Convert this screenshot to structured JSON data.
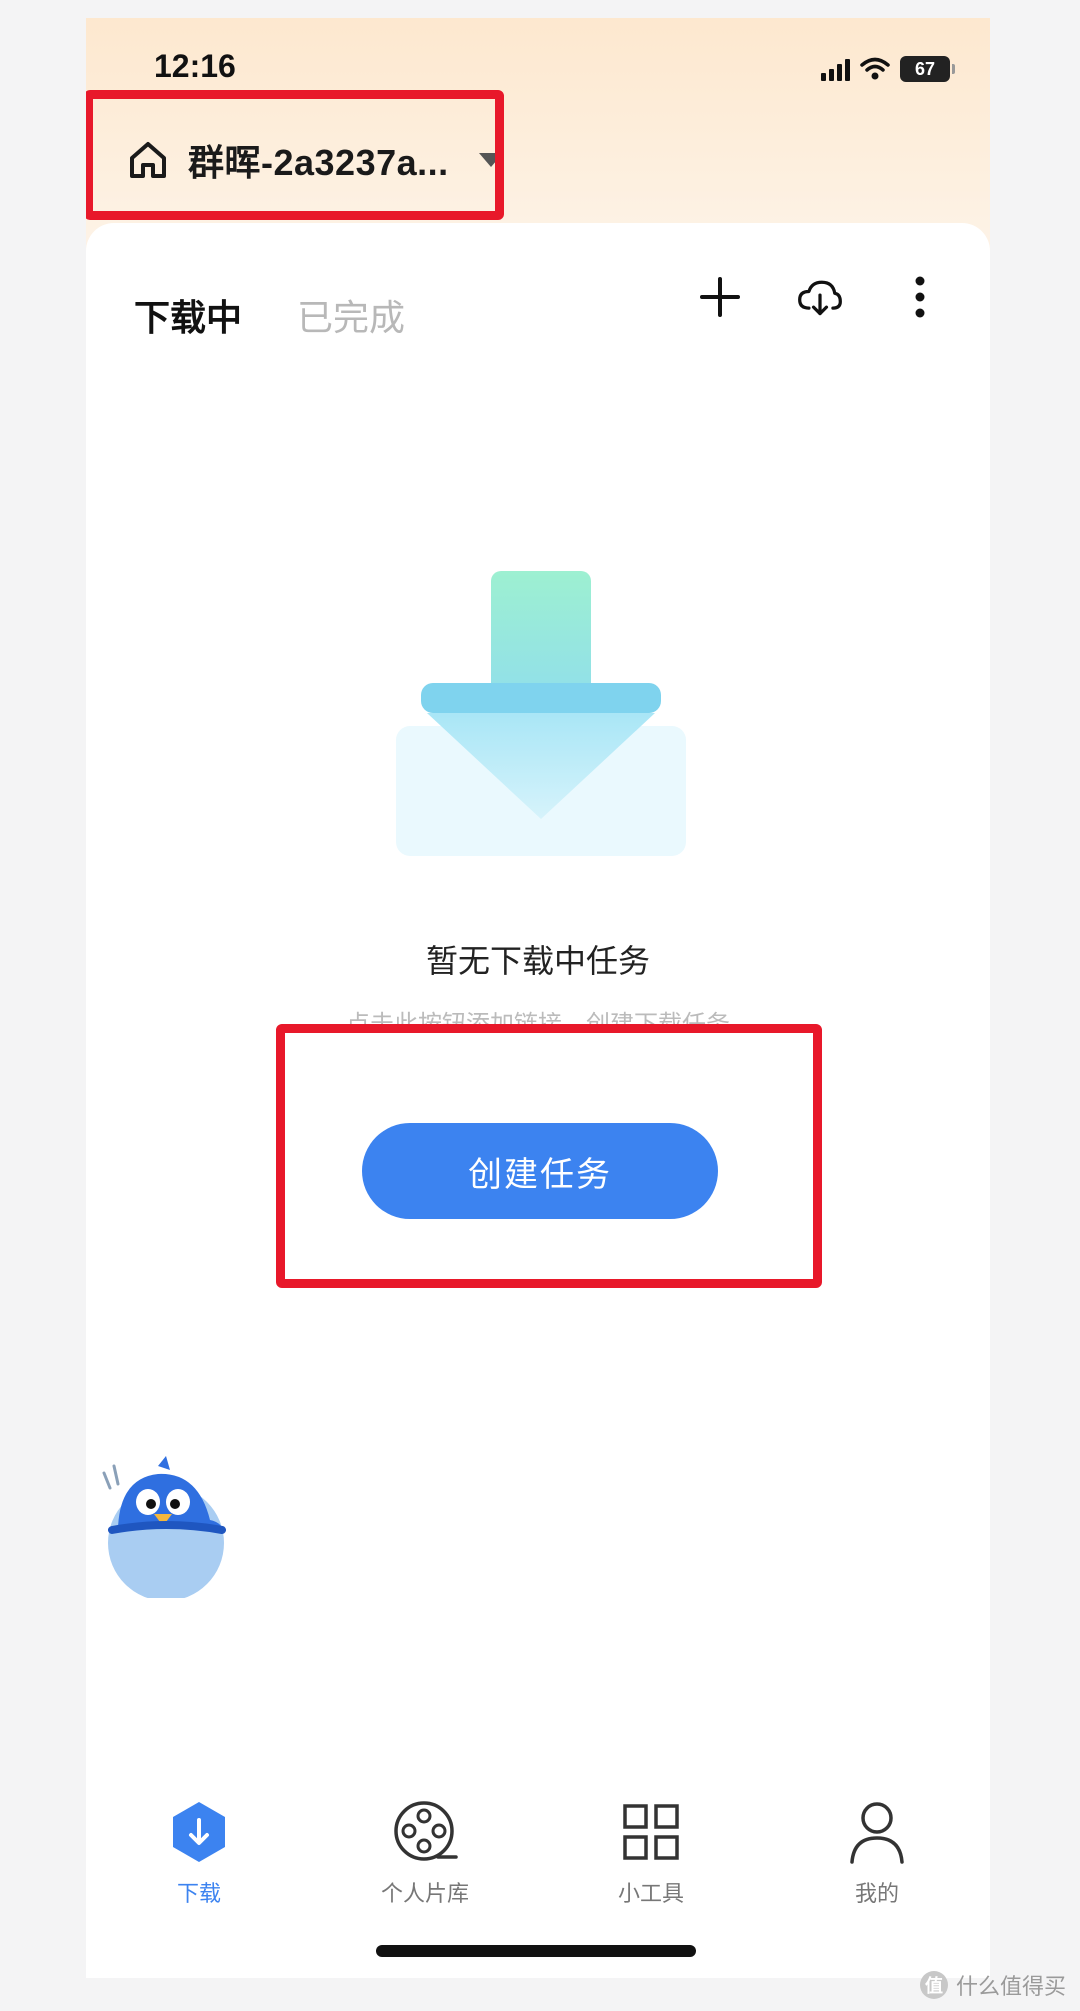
{
  "status_bar": {
    "time": "12:16",
    "battery": "67"
  },
  "header": {
    "device_name": "群晖-2a3237a..."
  },
  "tabs": [
    {
      "label": "下载中",
      "active": true
    },
    {
      "label": "已完成",
      "active": false
    }
  ],
  "toolbar": {
    "icons": [
      "plus-icon",
      "cloud-download-icon",
      "more-vertical-icon"
    ]
  },
  "empty_state": {
    "title": "暂无下载中任务",
    "hint": "点击此按钮添加链接，创建下载任务",
    "create_button_label": "创建任务"
  },
  "bottom_nav": [
    {
      "label": "下载",
      "icon": "download-hexagon-icon",
      "active": true
    },
    {
      "label": "个人片库",
      "icon": "film-reel-icon",
      "active": false
    },
    {
      "label": "小工具",
      "icon": "grid-icon",
      "active": false
    },
    {
      "label": "我的",
      "icon": "person-icon",
      "active": false
    }
  ],
  "colors": {
    "accent": "#3c83f0",
    "highlight": "#e8182a",
    "header_bg": "#fde8cf"
  },
  "watermark": {
    "text": "什么值得买",
    "logo": "值"
  }
}
